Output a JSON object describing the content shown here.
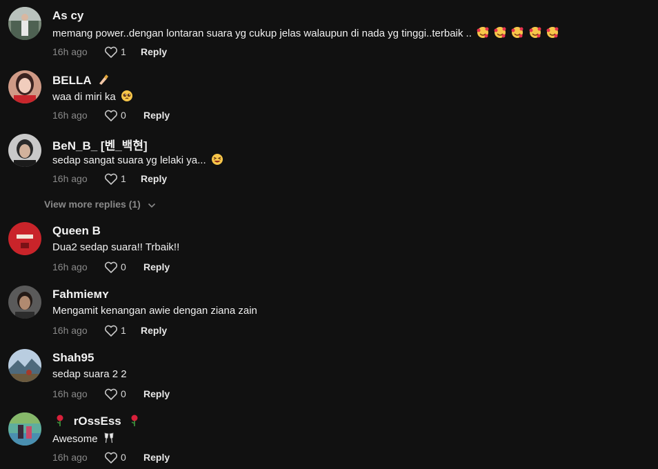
{
  "comments": [
    {
      "username": "As cy",
      "text": "memang power..dengan lontaran suara yg cukup jelas walaupun di nada yg tinggi..terbaik ..",
      "emoji": [
        "smiling-face-with-hearts-icon",
        "smiling-face-with-hearts-icon",
        "smiling-face-with-hearts-icon",
        "smiling-face-with-hearts-icon",
        "smiling-face-with-hearts-icon"
      ],
      "time": "16h ago",
      "likes": "1",
      "reply": "Reply"
    },
    {
      "username": "BELLA",
      "username_emoji": "nail-polish-icon",
      "text": "waa di miri ka",
      "emoji": [
        "pleading-face-icon"
      ],
      "time": "16h ago",
      "likes": "0",
      "reply": "Reply"
    },
    {
      "username": "BeN_B_ [벤_백현]",
      "text": "sedap sangat suara yg lelaki ya...",
      "emoji": [
        "grinning-squinting-face-icon"
      ],
      "time": "16h ago",
      "likes": "1",
      "reply": "Reply"
    },
    {
      "username": "Queen B",
      "text": "Dua2 sedap suara!! Trbaik!!",
      "time": "16h ago",
      "likes": "0",
      "reply": "Reply"
    },
    {
      "username": "Fahmieᴍʏ",
      "text": "Mengamit kenangan awie dengan ziana zain",
      "time": "16h ago",
      "likes": "1",
      "reply": "Reply"
    },
    {
      "username": "Shah95",
      "text": "sedap suara 2 2",
      "time": "16h ago",
      "likes": "0",
      "reply": "Reply"
    },
    {
      "username": "rOssEss",
      "username_emoji": "rose-icon",
      "text": "Awesome",
      "emoji": [
        "clinking-glasses-icon"
      ],
      "time": "16h ago",
      "likes": "0",
      "reply": "Reply"
    }
  ],
  "view_more_replies": "View more replies (1)",
  "colors": {
    "background": "#111111",
    "text": "#f1f1f1",
    "muted": "#8a8a8a"
  }
}
